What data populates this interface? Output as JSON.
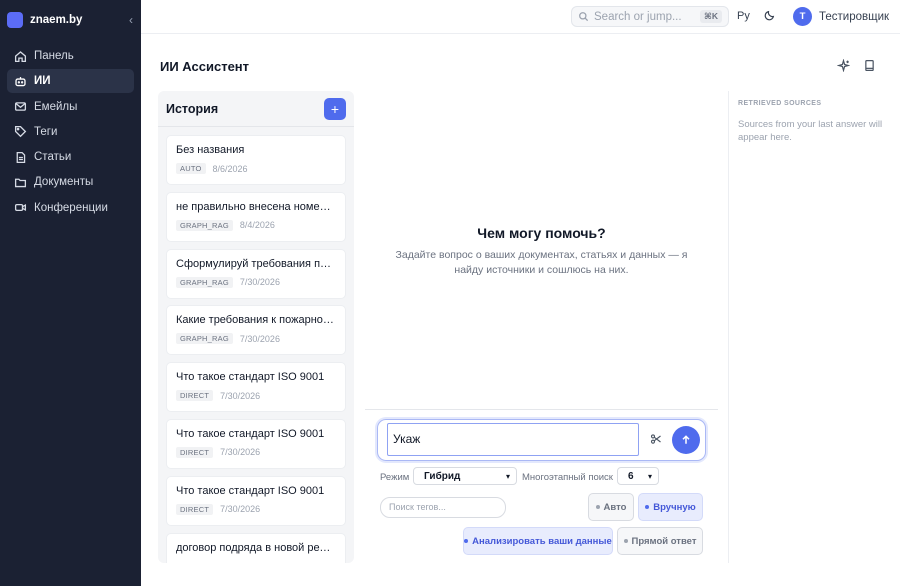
{
  "brand": {
    "name": "znaem.by"
  },
  "sidebar": {
    "items": [
      {
        "label": "Панель",
        "icon": "home-icon",
        "active": false
      },
      {
        "label": "ИИ",
        "icon": "bot-icon",
        "active": true
      },
      {
        "label": "Емейлы",
        "icon": "mail-icon",
        "active": false
      },
      {
        "label": "Теги",
        "icon": "tag-icon",
        "active": false
      },
      {
        "label": "Статьи",
        "icon": "document-icon",
        "active": false
      },
      {
        "label": "Документы",
        "icon": "folder-icon",
        "active": false
      },
      {
        "label": "Конференции",
        "icon": "video-icon",
        "active": false
      }
    ]
  },
  "topbar": {
    "search_placeholder": "Search or jump...",
    "search_shortcut": "⌘K",
    "language": "Ру",
    "user_initial": "Т",
    "user_name": "Тестировщик"
  },
  "page": {
    "title": "ИИ Ассистент"
  },
  "history": {
    "title": "История",
    "add_label": "+",
    "items": [
      {
        "title": "Без названия",
        "badge": "AUTO",
        "date": "8/6/2026"
      },
      {
        "title": "не правильно внесена номенклатура",
        "badge": "GRAPH_RAG",
        "date": "8/4/2026"
      },
      {
        "title": "Сформулируй требования по пожарной безопасности",
        "badge": "GRAPH_RAG",
        "date": "7/30/2026"
      },
      {
        "title": "Какие требования к пожарной безопасности",
        "badge": "GRAPH_RAG",
        "date": "7/30/2026"
      },
      {
        "title": "Что такое стандарт ISO 9001",
        "badge": "DIRECT",
        "date": "7/30/2026"
      },
      {
        "title": "Что такое стандарт ISO 9001",
        "badge": "DIRECT",
        "date": "7/30/2026"
      },
      {
        "title": "Что такое стандарт ISO 9001",
        "badge": "DIRECT",
        "date": "7/30/2026"
      },
      {
        "title": "договор подряда в новой редакции",
        "badge": "",
        "date": ""
      }
    ]
  },
  "chat": {
    "hero_title": "Чем могу помочь?",
    "hero_subtitle": "Задайте вопрос о ваших документах, статьях и данных — я найду источники и сошлюсь на них.",
    "input_value": "Укаж",
    "mode_label": "Режим",
    "mode_value": "Гибрид",
    "multistep_label": "Многоэтапный поиск",
    "multistep_value": "6",
    "tag_search_placeholder": "Поиск тегов...",
    "btn_auto": "Авто",
    "btn_manual": "Вручную",
    "btn_analyze": "Анализировать ваши данные",
    "btn_direct": "Прямой ответ"
  },
  "sources": {
    "title": "RETRIEVED SOURCES",
    "empty_text": "Sources from your last answer will appear here."
  },
  "colors": {
    "accent": "#4f6bed",
    "sidebar_bg": "#1b2133"
  }
}
